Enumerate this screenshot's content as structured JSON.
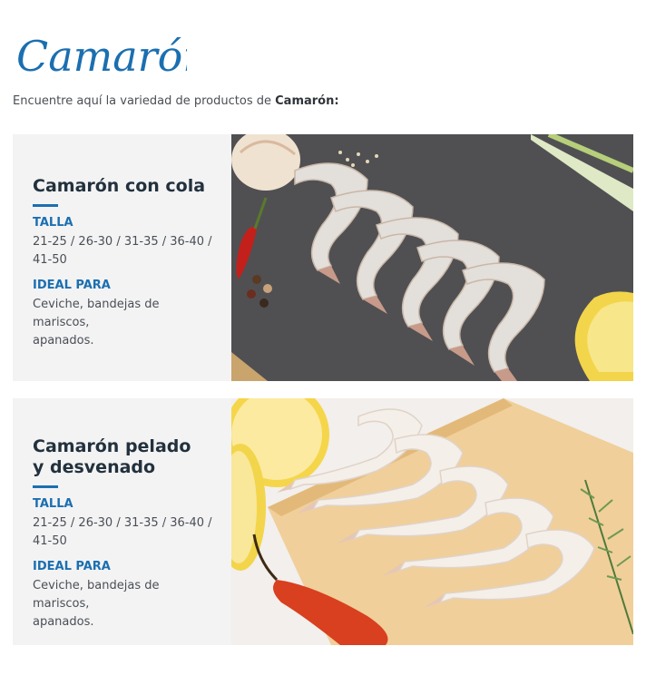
{
  "header": {
    "logo_text": "Camarón",
    "intro_text": "Encuentre aquí la variedad de productos de ",
    "intro_bold": "Camarón:"
  },
  "colors": {
    "brand": "#1b6fb0",
    "card_bg": "#f3f3f4",
    "title": "#22313d"
  },
  "products": [
    {
      "title_lines": [
        "Camarón con cola"
      ],
      "size_label": "TALLA",
      "sizes_lines": [
        "21-25 / 26-30 / 31-35 / 36-40 /",
        "41-50"
      ],
      "ideal_label": "IDEAL PARA",
      "ideal_lines": [
        "Ceviche, bandejas de mariscos,",
        "apanados."
      ],
      "photo": "shell-on-shrimp-on-slate-photo"
    },
    {
      "title_lines": [
        "Camarón pelado",
        "y desvenado"
      ],
      "size_label": "TALLA",
      "sizes_lines": [
        "21-25 / 26-30 / 31-35 / 36-40 /",
        "41-50"
      ],
      "ideal_label": "IDEAL PARA",
      "ideal_lines": [
        "Ceviche, bandejas de mariscos,",
        "apanados."
      ],
      "photo": "peeled-shrimp-on-board-photo"
    }
  ]
}
